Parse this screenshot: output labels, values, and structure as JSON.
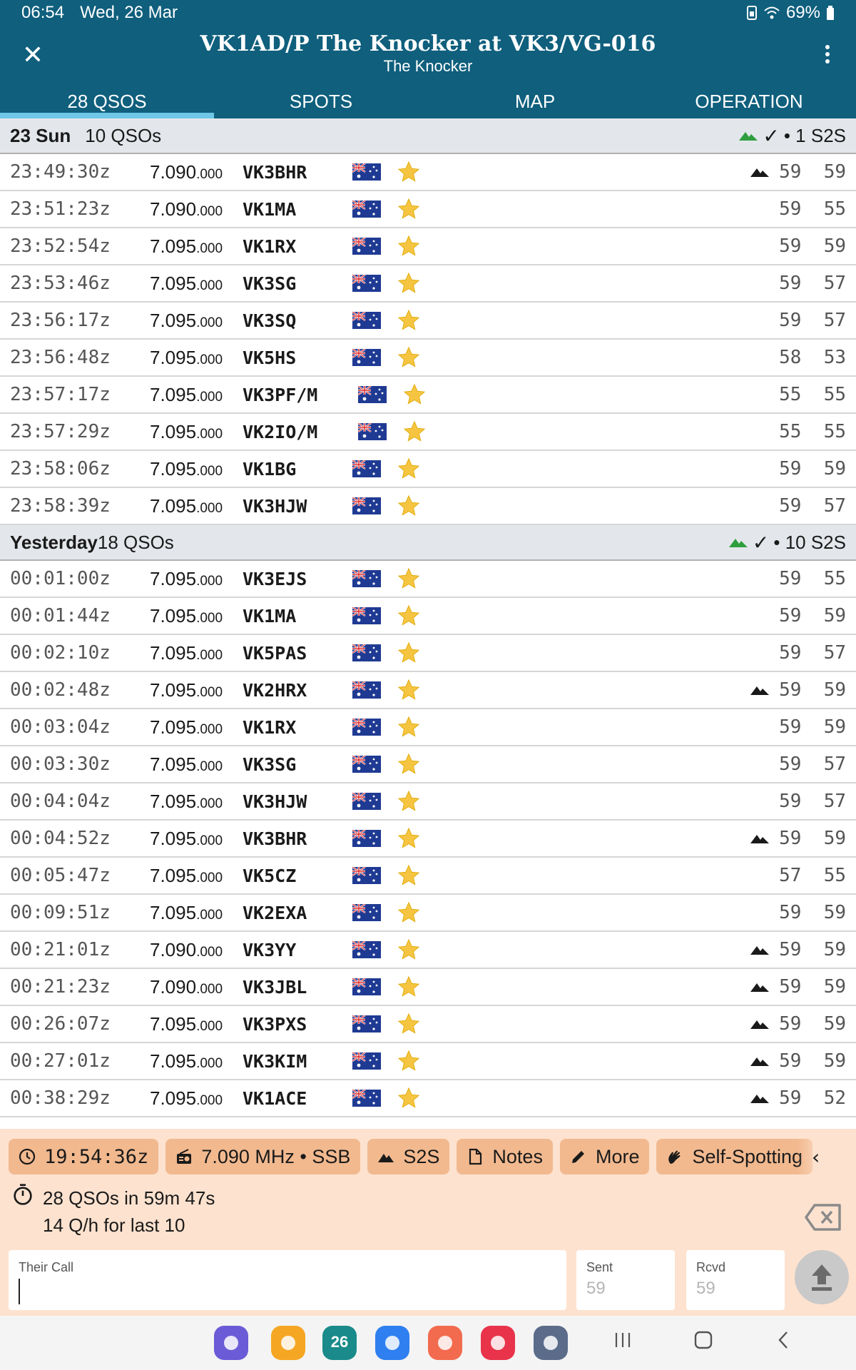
{
  "status_bar": {
    "time": "06:54",
    "date": "Wed, 26 Mar",
    "battery": "69%"
  },
  "app_bar": {
    "title": "VK1AD/P The Knocker at VK3/VG-016",
    "subtitle": "The Knocker"
  },
  "tabs": [
    {
      "label": "28 QSOS",
      "active": true
    },
    {
      "label": "SPOTS",
      "active": false
    },
    {
      "label": "MAP",
      "active": false
    },
    {
      "label": "OPERATION",
      "active": false
    }
  ],
  "sections": [
    {
      "day": "23 Sun",
      "count": "10 QSOs",
      "s2s_summary": "• 1 S2S",
      "rows": [
        {
          "time": "23:49:30z",
          "mhz": "7.090",
          "khz": ".000",
          "call": "VK3BHR",
          "s2s": true,
          "rst": "59  59"
        },
        {
          "time": "23:51:23z",
          "mhz": "7.090",
          "khz": ".000",
          "call": "VK1MA",
          "s2s": false,
          "rst": "59  55"
        },
        {
          "time": "23:52:54z",
          "mhz": "7.095",
          "khz": ".000",
          "call": "VK1RX",
          "s2s": false,
          "rst": "59  59"
        },
        {
          "time": "23:53:46z",
          "mhz": "7.095",
          "khz": ".000",
          "call": "VK3SG",
          "s2s": false,
          "rst": "59  57"
        },
        {
          "time": "23:56:17z",
          "mhz": "7.095",
          "khz": ".000",
          "call": "VK3SQ",
          "s2s": false,
          "rst": "59  57"
        },
        {
          "time": "23:56:48z",
          "mhz": "7.095",
          "khz": ".000",
          "call": "VK5HS",
          "s2s": false,
          "rst": "58  53"
        },
        {
          "time": "23:57:17z",
          "mhz": "7.095",
          "khz": ".000",
          "call": "VK3PF/M",
          "s2s": false,
          "rst": "55  55"
        },
        {
          "time": "23:57:29z",
          "mhz": "7.095",
          "khz": ".000",
          "call": "VK2IO/M",
          "s2s": false,
          "rst": "55  55"
        },
        {
          "time": "23:58:06z",
          "mhz": "7.095",
          "khz": ".000",
          "call": "VK1BG",
          "s2s": false,
          "rst": "59  59"
        },
        {
          "time": "23:58:39z",
          "mhz": "7.095",
          "khz": ".000",
          "call": "VK3HJW",
          "s2s": false,
          "rst": "59  57"
        }
      ]
    },
    {
      "day": "Yesterday",
      "count": "18 QSOs",
      "s2s_summary": "• 10 S2S",
      "rows": [
        {
          "time": "00:01:00z",
          "mhz": "7.095",
          "khz": ".000",
          "call": "VK3EJS",
          "s2s": false,
          "rst": "59  55"
        },
        {
          "time": "00:01:44z",
          "mhz": "7.095",
          "khz": ".000",
          "call": "VK1MA",
          "s2s": false,
          "rst": "59  59"
        },
        {
          "time": "00:02:10z",
          "mhz": "7.095",
          "khz": ".000",
          "call": "VK5PAS",
          "s2s": false,
          "rst": "59  57"
        },
        {
          "time": "00:02:48z",
          "mhz": "7.095",
          "khz": ".000",
          "call": "VK2HRX",
          "s2s": true,
          "rst": "59  59"
        },
        {
          "time": "00:03:04z",
          "mhz": "7.095",
          "khz": ".000",
          "call": "VK1RX",
          "s2s": false,
          "rst": "59  59"
        },
        {
          "time": "00:03:30z",
          "mhz": "7.095",
          "khz": ".000",
          "call": "VK3SG",
          "s2s": false,
          "rst": "59  57"
        },
        {
          "time": "00:04:04z",
          "mhz": "7.095",
          "khz": ".000",
          "call": "VK3HJW",
          "s2s": false,
          "rst": "59  57"
        },
        {
          "time": "00:04:52z",
          "mhz": "7.095",
          "khz": ".000",
          "call": "VK3BHR",
          "s2s": true,
          "rst": "59  59"
        },
        {
          "time": "00:05:47z",
          "mhz": "7.095",
          "khz": ".000",
          "call": "VK5CZ",
          "s2s": false,
          "rst": "57  55"
        },
        {
          "time": "00:09:51z",
          "mhz": "7.095",
          "khz": ".000",
          "call": "VK2EXA",
          "s2s": false,
          "rst": "59  59"
        },
        {
          "time": "00:21:01z",
          "mhz": "7.090",
          "khz": ".000",
          "call": "VK3YY",
          "s2s": true,
          "rst": "59  59"
        },
        {
          "time": "00:21:23z",
          "mhz": "7.090",
          "khz": ".000",
          "call": "VK3JBL",
          "s2s": true,
          "rst": "59  59"
        },
        {
          "time": "00:26:07z",
          "mhz": "7.095",
          "khz": ".000",
          "call": "VK3PXS",
          "s2s": true,
          "rst": "59  59"
        },
        {
          "time": "00:27:01z",
          "mhz": "7.095",
          "khz": ".000",
          "call": "VK3KIM",
          "s2s": true,
          "rst": "59  59"
        },
        {
          "time": "00:38:29z",
          "mhz": "7.095",
          "khz": ".000",
          "call": "VK1ACE",
          "s2s": true,
          "rst": "59  52"
        }
      ]
    }
  ],
  "chips": [
    {
      "icon": "clock-icon",
      "label": "19:54:36z"
    },
    {
      "icon": "radio-icon",
      "label": "7.090 MHz • SSB"
    },
    {
      "icon": "mountain-icon",
      "label": "S2S"
    },
    {
      "icon": "notes-icon",
      "label": "Notes"
    },
    {
      "icon": "pencil-icon",
      "label": "More"
    },
    {
      "icon": "hand-icon",
      "label": "Self-Spotting"
    }
  ],
  "stats": {
    "line1": "28 QSOs in 59m 47s",
    "line2": "14 Q/h for last 10"
  },
  "inputs": {
    "call_label": "Their Call",
    "call_value": "",
    "sent_label": "Sent",
    "sent_placeholder": "59",
    "rcvd_label": "Rcvd",
    "rcvd_placeholder": "59"
  },
  "nav_apps": [
    {
      "icon": "internet-icon",
      "color": "#6b5bd6"
    },
    {
      "icon": "folder-icon",
      "color": "#f5a623"
    },
    {
      "icon": "calendar-icon",
      "color": "#1a8a8a",
      "label": "26"
    },
    {
      "icon": "messages-icon",
      "color": "#2f7ff0"
    },
    {
      "icon": "contacts-icon",
      "color": "#f26b4f"
    },
    {
      "icon": "camera-icon",
      "color": "#e8334a"
    },
    {
      "icon": "apps-grid-icon",
      "color": "#5b6b8a"
    }
  ],
  "colors": {
    "primary": "#0f5f7d",
    "tab_indicator": "#6fc7e8",
    "panel_bg": "#fde2cf",
    "chip_bg": "#f2b98f",
    "star": "#f5c542",
    "s2s_green": "#2e9e3e"
  }
}
